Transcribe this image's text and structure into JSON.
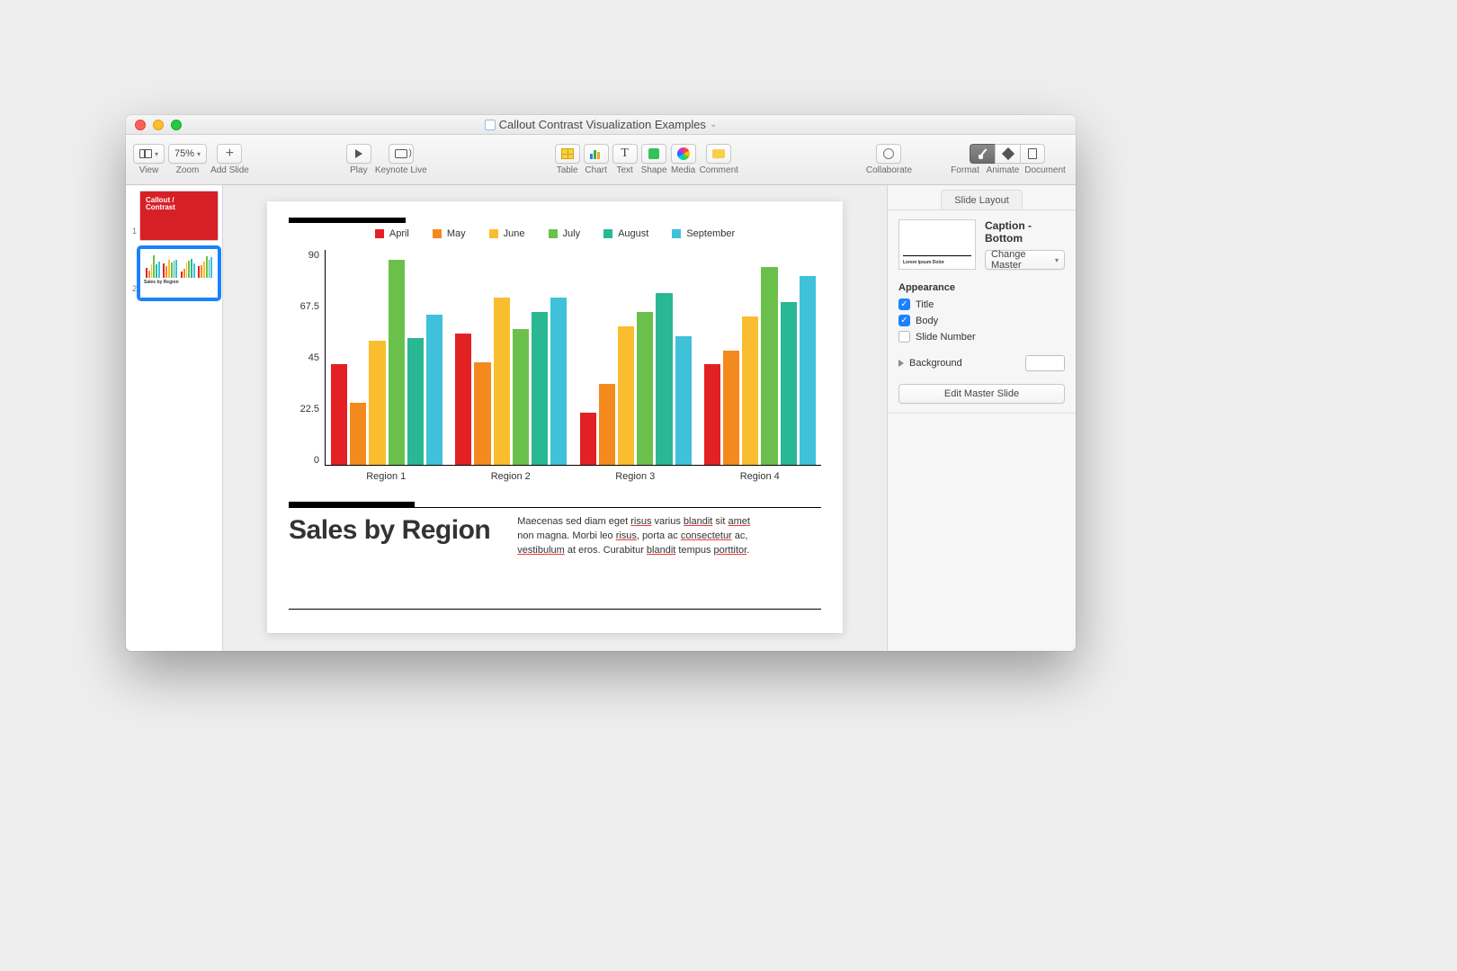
{
  "window": {
    "title": "Callout Contrast Visualization Examples"
  },
  "toolbar": {
    "view": "View",
    "zoom_value": "75%",
    "zoom": "Zoom",
    "add_slide": "Add Slide",
    "play": "Play",
    "keynote_live": "Keynote Live",
    "table": "Table",
    "chart": "Chart",
    "text": "Text",
    "shape": "Shape",
    "media": "Media",
    "comment": "Comment",
    "collaborate": "Collaborate",
    "format": "Format",
    "animate": "Animate",
    "document": "Document"
  },
  "thumbnails": [
    {
      "n": "1",
      "title_a": "Callout /",
      "title_b": "Contrast"
    },
    {
      "n": "2",
      "caption": "Sales by Region"
    }
  ],
  "slide": {
    "title": "Sales by Region",
    "body": "Maecenas sed diam eget risus varius blandit sit amet non magna. Morbi leo risus, porta ac consectetur ac, vestibulum at eros. Curabitur blandit tempus porttitor."
  },
  "chart_data": {
    "type": "bar",
    "series": [
      {
        "name": "April",
        "color": "#e32124"
      },
      {
        "name": "May",
        "color": "#f48a1e"
      },
      {
        "name": "June",
        "color": "#f9bd2f"
      },
      {
        "name": "July",
        "color": "#6bc04b"
      },
      {
        "name": "August",
        "color": "#2ab793"
      },
      {
        "name": "September",
        "color": "#3fc1d9"
      }
    ],
    "categories": [
      "Region 1",
      "Region 2",
      "Region 3",
      "Region 4"
    ],
    "values": [
      [
        42,
        26,
        52,
        86,
        53,
        63
      ],
      [
        55,
        43,
        70,
        57,
        64,
        70
      ],
      [
        22,
        34,
        58,
        64,
        72,
        54
      ],
      [
        42,
        48,
        62,
        83,
        68,
        79
      ]
    ],
    "y_ticks": [
      "90",
      "67.5",
      "45",
      "22.5",
      "0"
    ],
    "ylim": [
      0,
      90
    ],
    "xlabel": "",
    "ylabel": "",
    "title": ""
  },
  "inspector": {
    "tab": "Slide Layout",
    "master_name": "Caption - Bottom",
    "change_master": "Change Master",
    "appearance": "Appearance",
    "title_chk": "Title",
    "body_chk": "Body",
    "slide_number_chk": "Slide Number",
    "background": "Background",
    "edit_master": "Edit Master Slide"
  }
}
